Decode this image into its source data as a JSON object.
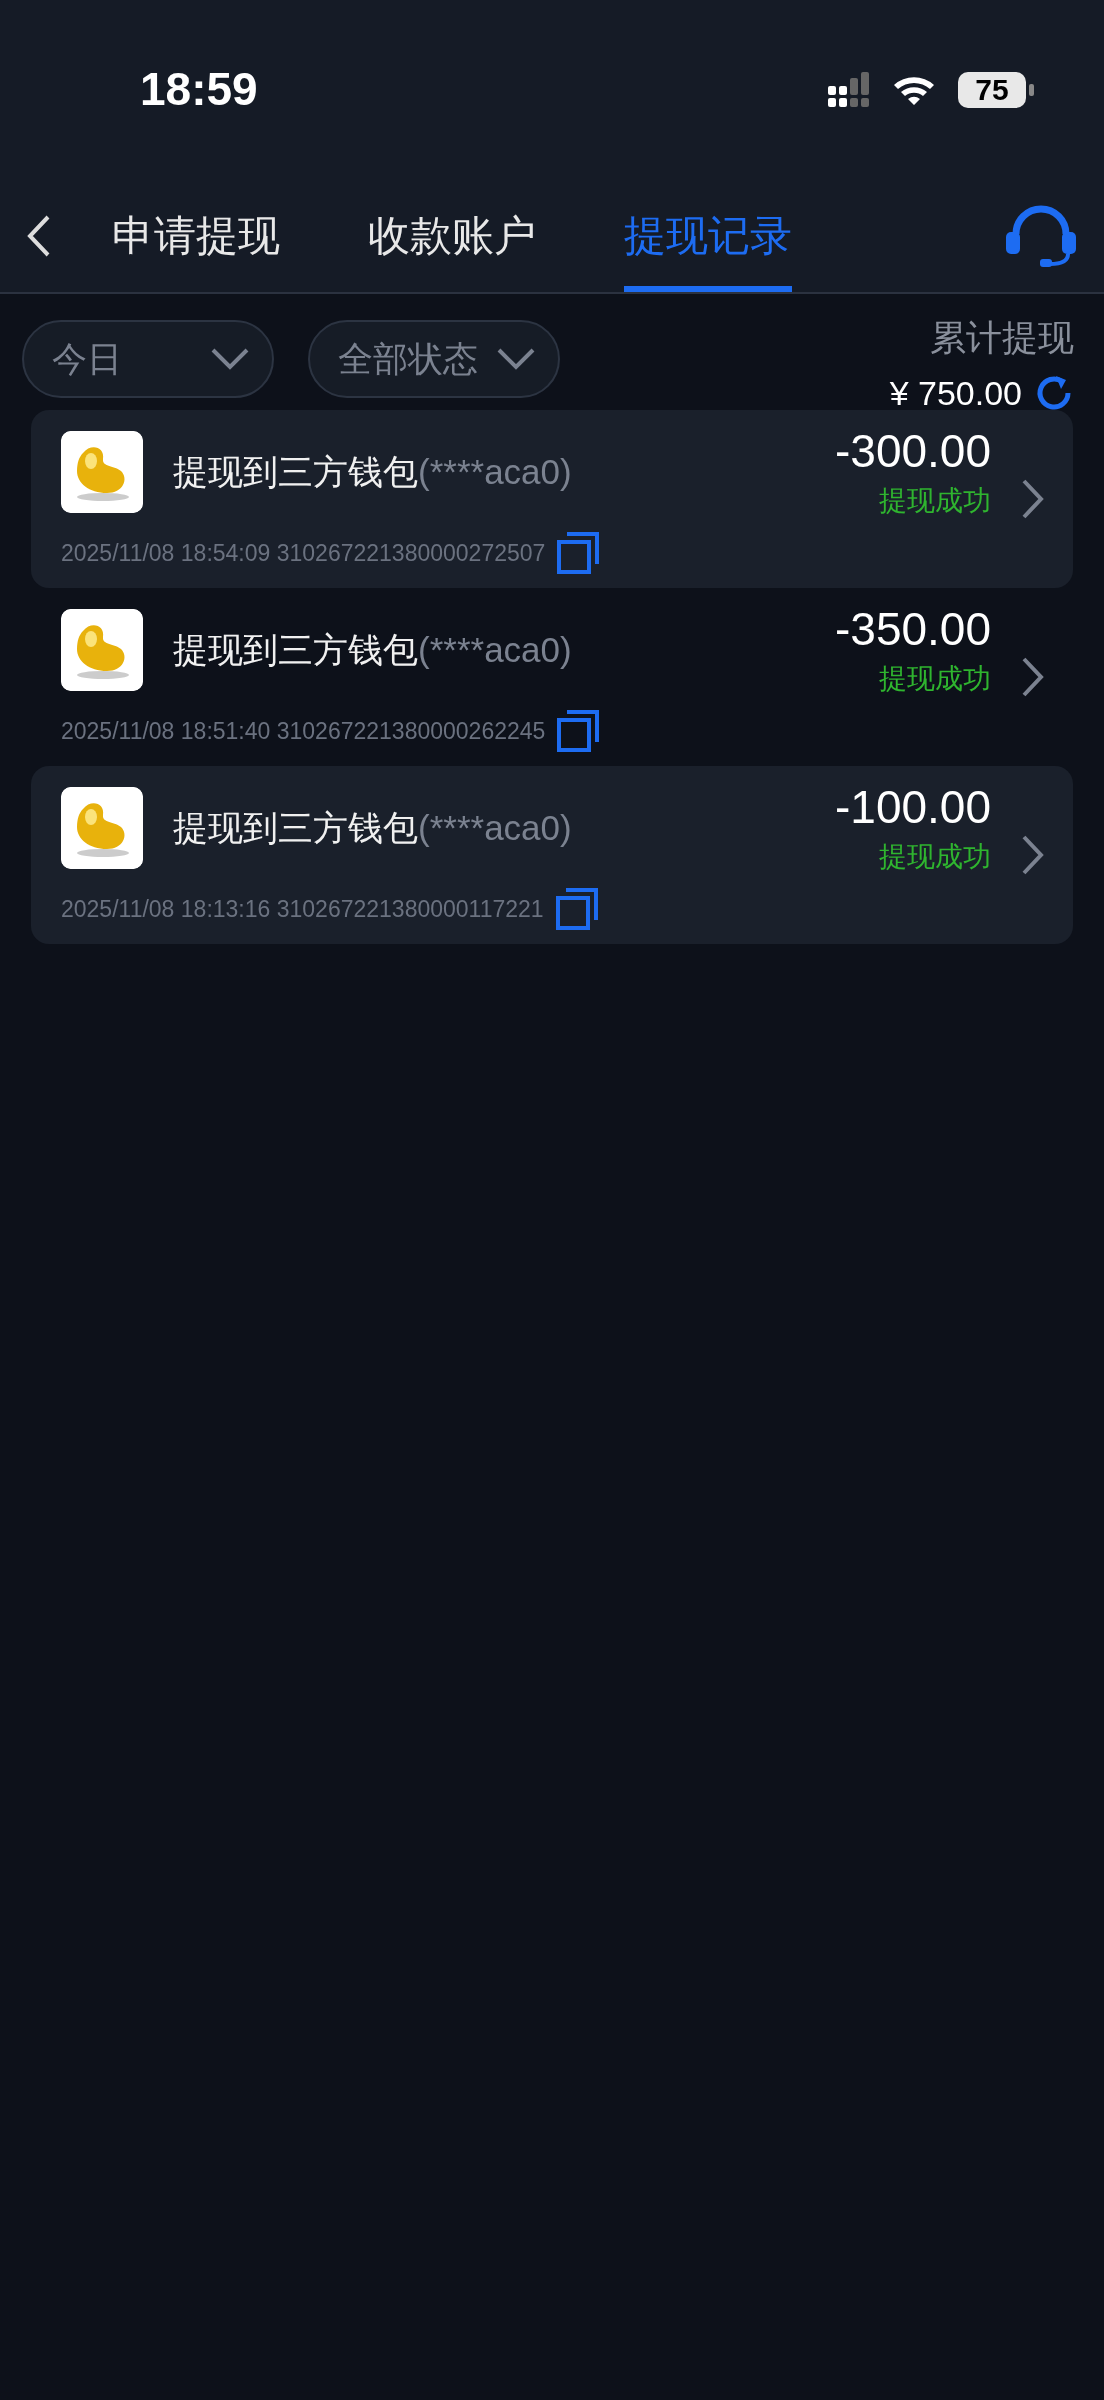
{
  "status_bar": {
    "time": "18:59",
    "battery": "75"
  },
  "tabs": [
    {
      "label": "申请提现",
      "selected": false
    },
    {
      "label": "收款账户",
      "selected": false
    },
    {
      "label": "提现记录",
      "selected": true
    }
  ],
  "filters": [
    {
      "label": "今日"
    },
    {
      "label": "全部状态"
    }
  ],
  "total": {
    "label": "累计提现",
    "amount": "¥ 750.00"
  },
  "records": [
    {
      "title": "提现到三方钱包",
      "account": "(****aca0)",
      "amount": "-300.00",
      "status": "提现成功",
      "time": "2025/11/08 18:54:09",
      "order_no": "310267221380000272507",
      "shaded": true
    },
    {
      "title": "提现到三方钱包",
      "account": "(****aca0)",
      "amount": "-350.00",
      "status": "提现成功",
      "time": "2025/11/08 18:51:40",
      "order_no": "310267221380000262245",
      "shaded": false
    },
    {
      "title": "提现到三方钱包",
      "account": "(****aca0)",
      "amount": "-100.00",
      "status": "提现成功",
      "time": "2025/11/08 18:13:16",
      "order_no": "310267221380000117221",
      "shaded": true
    }
  ]
}
